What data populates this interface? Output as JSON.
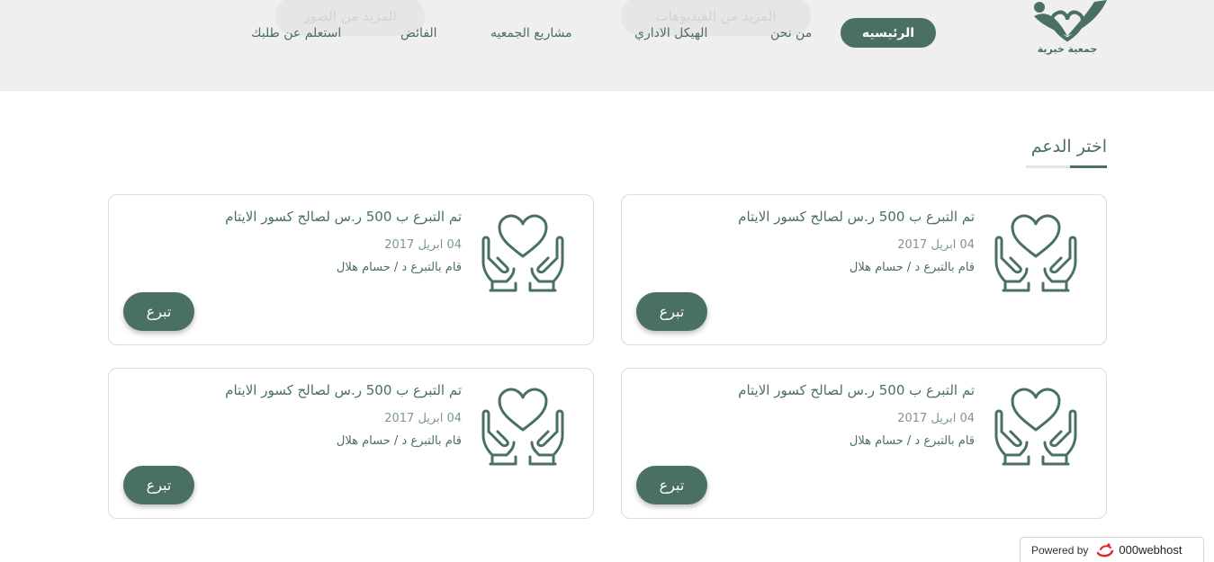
{
  "header": {
    "ghost_buttons": [
      "المزيد من الصور",
      "المزيد من الفيديوهات"
    ],
    "nav": {
      "active_label": "الرئيسيه",
      "items": [
        "من نحن",
        "الهيكل الاداري",
        "مشاريع الجمعيه",
        "الفائض",
        "استعلم عن طلبك"
      ]
    },
    "logo_text": "جمعية خيرية"
  },
  "section": {
    "title": "اختر الدعم"
  },
  "cards": [
    {
      "title": "تم التبرع ب 500 ر.س لصالح كسور الايتام",
      "date": "04 ابريل 2017",
      "donor": "قام بالتبرع د / حسام هلال",
      "button": "تبرع",
      "icon": "heart-in-hands-icon"
    },
    {
      "title": "تم التبرع ب 500 ر.س لصالح كسور الايتام",
      "date": "04 ابريل 2017",
      "donor": "قام بالتبرع د / حسام هلال",
      "button": "تبرع",
      "icon": "heart-in-hands-icon"
    },
    {
      "title": "تم التبرع ب 500 ر.س لصالح كسور الايتام",
      "date": "04 ابريل 2017",
      "donor": "قام بالتبرع د / حسام هلال",
      "button": "تبرع",
      "icon": "heart-in-hands-icon"
    },
    {
      "title": "تم التبرع ب 500 ر.س لصالح كسور الايتام",
      "date": "04 ابريل 2017",
      "donor": "قام بالتبرع د / حسام هلال",
      "button": "تبرع",
      "icon": "heart-in-hands-icon"
    }
  ],
  "footer_badge": {
    "prefix": "Powered by",
    "brand": "000webhost"
  },
  "colors": {
    "primary": "#4a6f65",
    "header_bg": "#efefef",
    "card_border": "#d9dedc"
  }
}
